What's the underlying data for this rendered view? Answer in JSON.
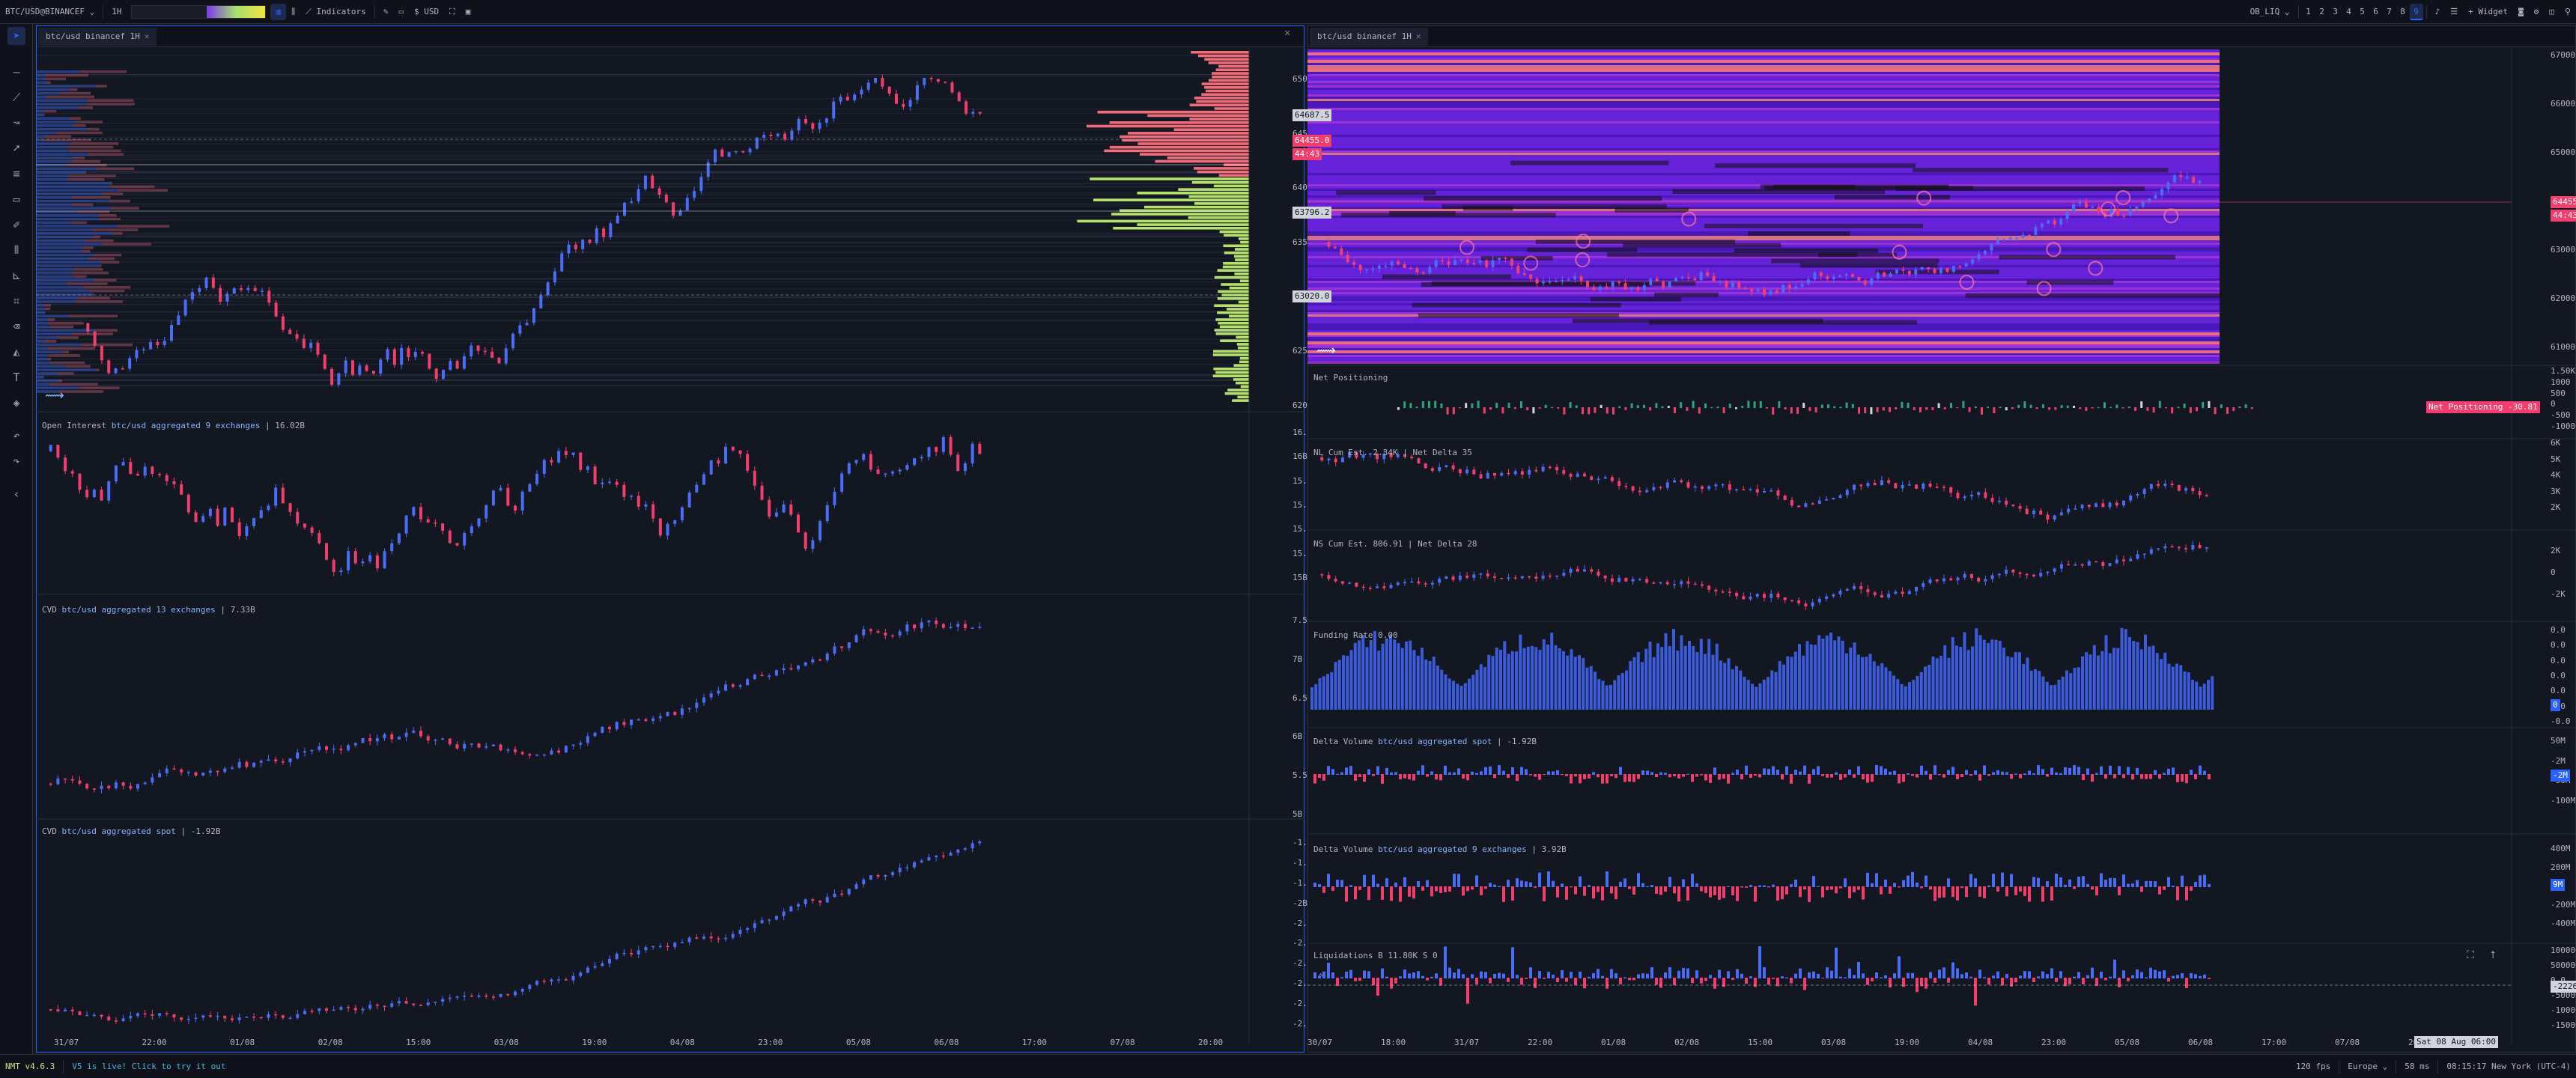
{
  "toolbar": {
    "symbol": "BTC/USD@BINANCEF",
    "timeframe": "1H",
    "indicators_label": "Indicators",
    "currency_label": "USD",
    "ob_liq_label": "OB_LIQ",
    "layouts": [
      "1",
      "2",
      "3",
      "4",
      "5",
      "6",
      "7",
      "8",
      "9"
    ],
    "active_layout": "9",
    "widget_label": "Widget"
  },
  "left_pane": {
    "tab_label": "btc/usd binancef 1H",
    "price_axis": [
      "65000.0",
      "64500.0",
      "64000.0",
      "63500.0",
      "63000.0",
      "62500.0",
      "62000.0"
    ],
    "price_tags": [
      {
        "text": "64687.5",
        "style": "white"
      },
      {
        "text": "64455.0",
        "style": "red"
      },
      {
        "text": "44:43",
        "style": "red"
      },
      {
        "text": "63796.2",
        "style": "white"
      },
      {
        "text": "63020.0",
        "style": "white"
      }
    ],
    "oi_label": "Open Interest",
    "oi_source": "btc/usd aggregated 9 exchanges",
    "oi_value": "16.02B",
    "oi_axis": [
      "16.20B",
      "16B",
      "15.80B",
      "15.60B",
      "15.40B",
      "15.20B",
      "15B"
    ],
    "cvd1_label": "CVD",
    "cvd1_source": "btc/usd aggregated 13 exchanges",
    "cvd1_value": "7.33B",
    "cvd1_axis": [
      "7.50B",
      "7B",
      "6.50B",
      "6B",
      "5.50B",
      "5B"
    ],
    "cvd2_label": "CVD",
    "cvd2_source": "btc/usd aggregated spot",
    "cvd2_value": "-1.92B",
    "cvd2_axis": [
      "-1.85B",
      "-1.90B",
      "-1.95B",
      "-2B",
      "-2.05B",
      "-2.10B",
      "-2.15B",
      "-2.20B",
      "-2.25B",
      "-2.30B"
    ],
    "time_axis": [
      "31/07",
      "22:00",
      "01/08",
      "02/08",
      "15:00",
      "03/08",
      "19:00",
      "04/08",
      "23:00",
      "05/08",
      "06/08",
      "17:00",
      "07/08",
      "20:00"
    ]
  },
  "right_pane": {
    "tab_label": "btc/usd binancef 1H",
    "price_axis": [
      "67000.0",
      "66000.0",
      "65000.0",
      "64000.0",
      "63000.0",
      "62000.0",
      "61000.0"
    ],
    "price_tags": [
      {
        "text": "64455.0",
        "style": "red"
      },
      {
        "text": "44:43",
        "style": "red"
      }
    ],
    "net_pos_label": "Net Positioning",
    "net_pos_tag": "Net Positioning -30.81",
    "net_pos_axis": [
      "1.50K",
      "1000",
      "500",
      "0",
      "-500",
      "-1000"
    ],
    "nl_label": "NL Cum Est. 2.34K | Net Delta 35",
    "nl_axis": [
      "6K",
      "5K",
      "4K",
      "3K",
      "2K"
    ],
    "ns_label": "NS Cum Est. 806.91 | Net Delta 28",
    "ns_axis": [
      "2K",
      "0",
      "-2K"
    ],
    "funding_label": "Funding Rate 0.00",
    "funding_axis": [
      "0.0",
      "0.0",
      "0.0",
      "0.0",
      "0.0",
      "0.0",
      "-0.0"
    ],
    "funding_tag": "0",
    "dv1_label": "Delta Volume",
    "dv1_source": "btc/usd aggregated spot",
    "dv1_value": "-1.92B",
    "dv1_axis": [
      "50M",
      "-2M",
      "-50M",
      "-100M"
    ],
    "dv1_tag": "-2M",
    "dv2_label": "Delta Volume",
    "dv2_source": "btc/usd aggregated 9 exchanges",
    "dv2_value": "3.92B",
    "dv2_axis": [
      "400M",
      "200M",
      "0",
      "-200M",
      "-400M"
    ],
    "dv2_tag": "9M",
    "liq_label": "Liquidations B 11.80K S 0",
    "liq_axis": [
      "10000000.0",
      "5000000.0",
      "0.0",
      "-5000000.0",
      "-10000000.0",
      "-15000000.0"
    ],
    "liq_tag": "-2226547.2",
    "time_axis": [
      "30/07",
      "18:00",
      "31/07",
      "22:00",
      "01/08",
      "02/08",
      "15:00",
      "03/08",
      "19:00",
      "04/08",
      "23:00",
      "05/08",
      "06/08",
      "17:00",
      "07/08",
      "20"
    ],
    "crosshair_time": "Sat 08 Aug 06:00"
  },
  "status": {
    "version": "NMT v4.6.3",
    "news": "V5 is live! Click to try it out",
    "fps": "120 fps",
    "region": "Europe",
    "latency": "58 ms",
    "clock": "08:15:17 New York (UTC-4)"
  },
  "colors": {
    "bg": "#131722",
    "up": "#4a6cf7",
    "down": "#f23d6d",
    "selected_border": "#2962ff",
    "heat_purple": "#5b1fcf"
  }
}
